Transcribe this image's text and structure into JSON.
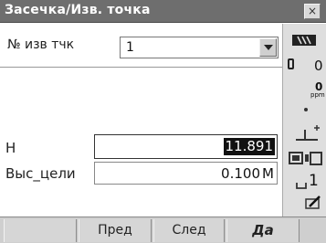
{
  "window": {
    "title": "Засечка/Изв. точка",
    "close_label": "×"
  },
  "point": {
    "label": "№ изв тчк",
    "value": "1"
  },
  "fields": {
    "h_label": "H",
    "h_value": "11.891",
    "target_label": "Выс_цели",
    "target_value": "0.100",
    "target_unit": "M"
  },
  "status": {
    "signal_icon": "signal-icon",
    "prism_constant": "0",
    "ppm_value": "0",
    "ppm_label": "ppm",
    "compensator_icon": "tilt-compensator-icon",
    "input_mode": "1"
  },
  "softkeys": {
    "key1": "",
    "key2": "Пред",
    "key3": "След",
    "key4": "Да"
  }
}
